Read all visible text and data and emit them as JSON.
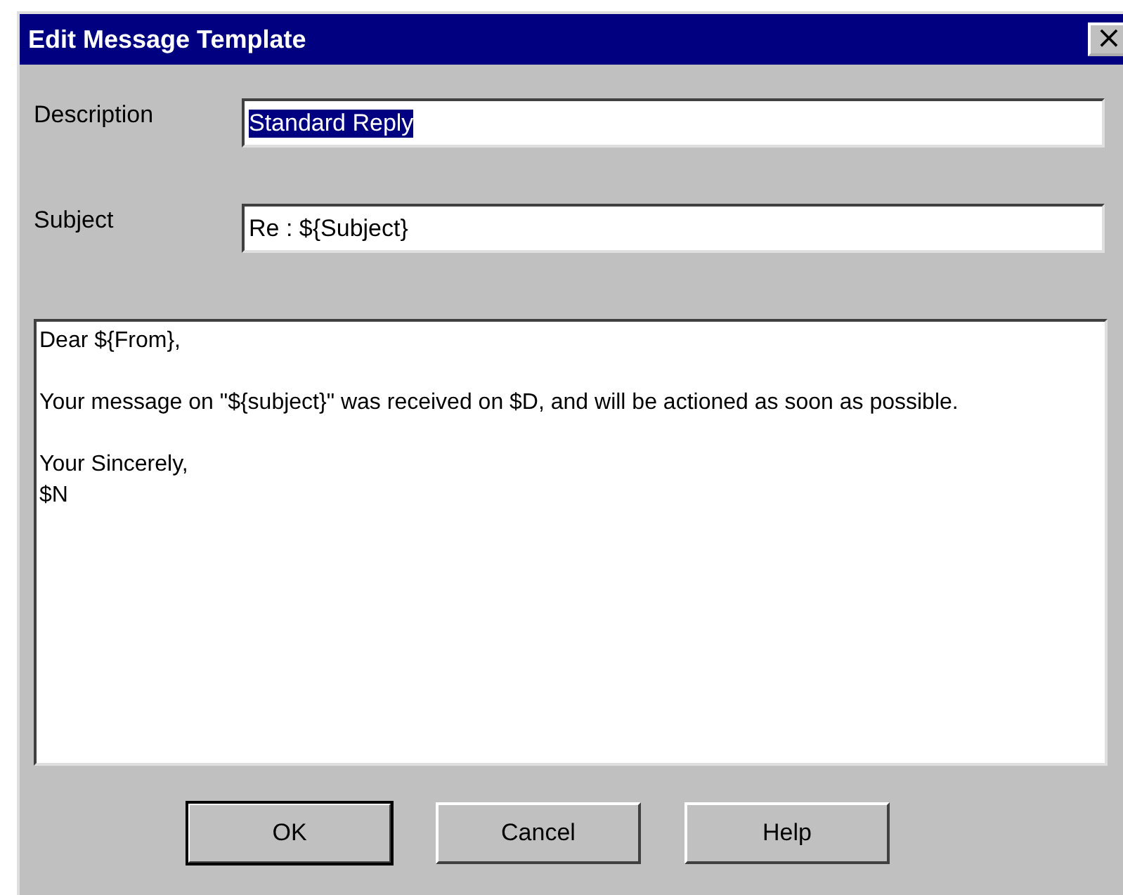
{
  "window": {
    "title": "Edit Message Template",
    "close": "×"
  },
  "fields": [
    {
      "label": "Description",
      "value": "Standard Reply",
      "selected": true
    },
    {
      "label": "Subject",
      "value": "Re : ${Subject}",
      "selected": false
    }
  ],
  "body": {
    "paragraphs": [
      [
        "Dear ${From},"
      ],
      [
        "Your message on \"${subject}\" was received on $D, and will be actioned as soon as possible."
      ],
      [
        "Your Sincerely,",
        "$N"
      ]
    ]
  },
  "buttons": [
    {
      "label": "OK",
      "default": true
    },
    {
      "label": "Cancel",
      "default": false
    },
    {
      "label": "Help",
      "default": false
    }
  ]
}
